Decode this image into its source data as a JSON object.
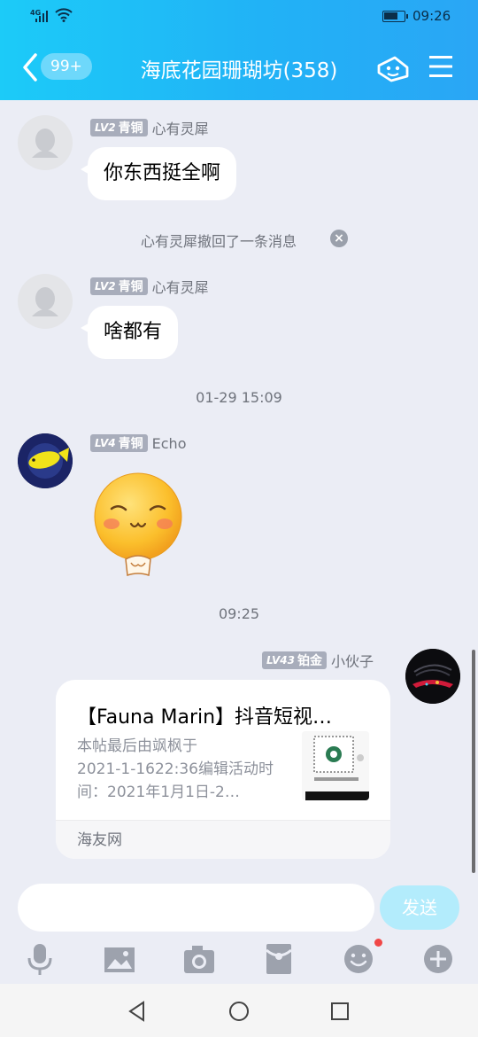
{
  "status_bar": {
    "network": "4G",
    "time": "09:26"
  },
  "header": {
    "back_badge": "99+",
    "title": "海底花园珊瑚坊(358)",
    "icons": [
      "back-chevron-icon",
      "group-game-icon",
      "menu-icon"
    ]
  },
  "messages": [
    {
      "level_prefix": "LV2",
      "level_name": "青铜",
      "sender": "心有灵犀",
      "text": "你东西挺全啊"
    },
    {
      "system": "心有灵犀撤回了一条消息"
    },
    {
      "level_prefix": "LV2",
      "level_name": "青铜",
      "sender": "心有灵犀",
      "text": "啥都有"
    },
    {
      "timestamp": "01-29 15:09"
    },
    {
      "level_prefix": "LV4",
      "level_name": "青铜",
      "sender": "Echo",
      "sticker": "shy-face-sticker"
    },
    {
      "timestamp": "09:25"
    },
    {
      "level_prefix": "LV43",
      "level_name": "铂金",
      "sender": "小伙子",
      "card": {
        "title": "【Fauna Marin】抖音短视…",
        "desc_lines": [
          "本帖最后由飒枫于",
          "2021-1-1622:36编辑活动时",
          "间：2021年1月1日-2…"
        ],
        "source": "海友网",
        "thumb": "qr-code-image"
      }
    }
  ],
  "input": {
    "value": "",
    "send_label": "发送"
  },
  "toolbar": [
    "microphone-icon",
    "image-icon",
    "camera-icon",
    "red-packet-icon",
    "emoji-icon",
    "plus-icon"
  ],
  "colors": {
    "header_start": "#1ccbf8",
    "header_end": "#2aa6f5",
    "background": "#ebedf5",
    "send_button": "#b3ecfc",
    "badge_dot": "#f04747"
  }
}
